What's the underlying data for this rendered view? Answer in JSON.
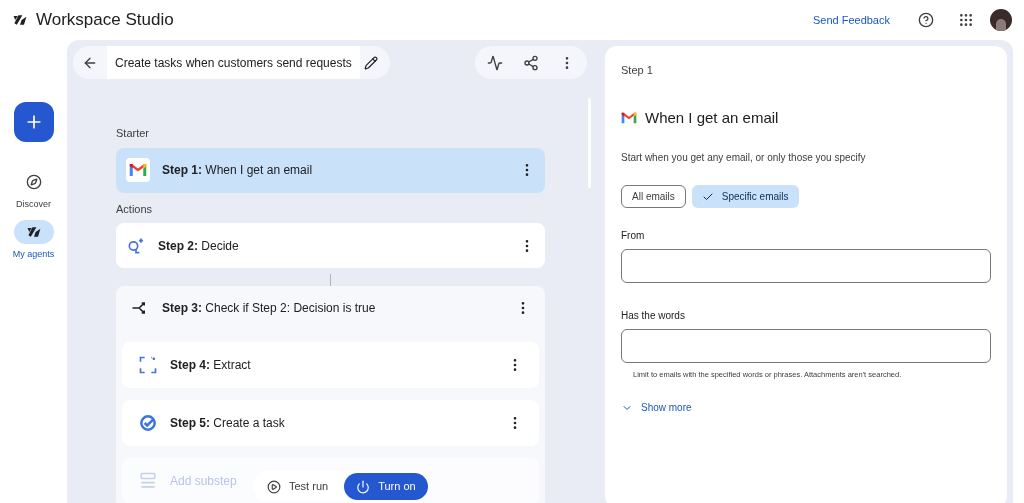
{
  "app": {
    "title": "Workspace Studio",
    "feedback": "Send Feedback"
  },
  "nav": [
    {
      "label": "Discover",
      "kind": "discover",
      "selected": false
    },
    {
      "label": "My agents",
      "kind": "agents",
      "selected": true
    }
  ],
  "flow": {
    "title": "Create tasks when customers send requests",
    "sections": [
      {
        "heading": "Starter",
        "steps": [
          {
            "kind": "email",
            "label": "**Step 1:** When I get an email",
            "selected": true
          }
        ]
      },
      {
        "heading": "Actions",
        "steps": [
          {
            "kind": "decide",
            "label": "**Step 2:** Decide",
            "selected": false
          },
          {
            "kind": "branch",
            "label": "**Step 3:** Check if Step 2: Decision is true",
            "selected": false,
            "children": [
              {
                "kind": "extract",
                "label": "**Step 4:** Extract",
                "selected": false
              },
              {
                "kind": "task",
                "label": "**Step 5:** Create a task",
                "selected": false
              },
              {
                "kind": "add",
                "label": "Add substep",
                "selected": false
              }
            ]
          }
        ]
      }
    ],
    "actions": [
      {
        "kind": "test",
        "label": "Test run"
      },
      {
        "kind": "turnon",
        "label": "Turn on"
      }
    ]
  },
  "panel": {
    "step": "Step 1",
    "title": "When I get an email",
    "description": "Start when you get any email, or only those you specify",
    "chips": [
      {
        "label": "All emails",
        "selected": false
      },
      {
        "label": "Specific emails",
        "selected": true
      }
    ],
    "fields": [
      {
        "label": "From"
      },
      {
        "label": "Has the words",
        "hint": "Limit to emails with the specified words or phrases. Attachments aren't searched."
      }
    ],
    "more": "Show more"
  }
}
